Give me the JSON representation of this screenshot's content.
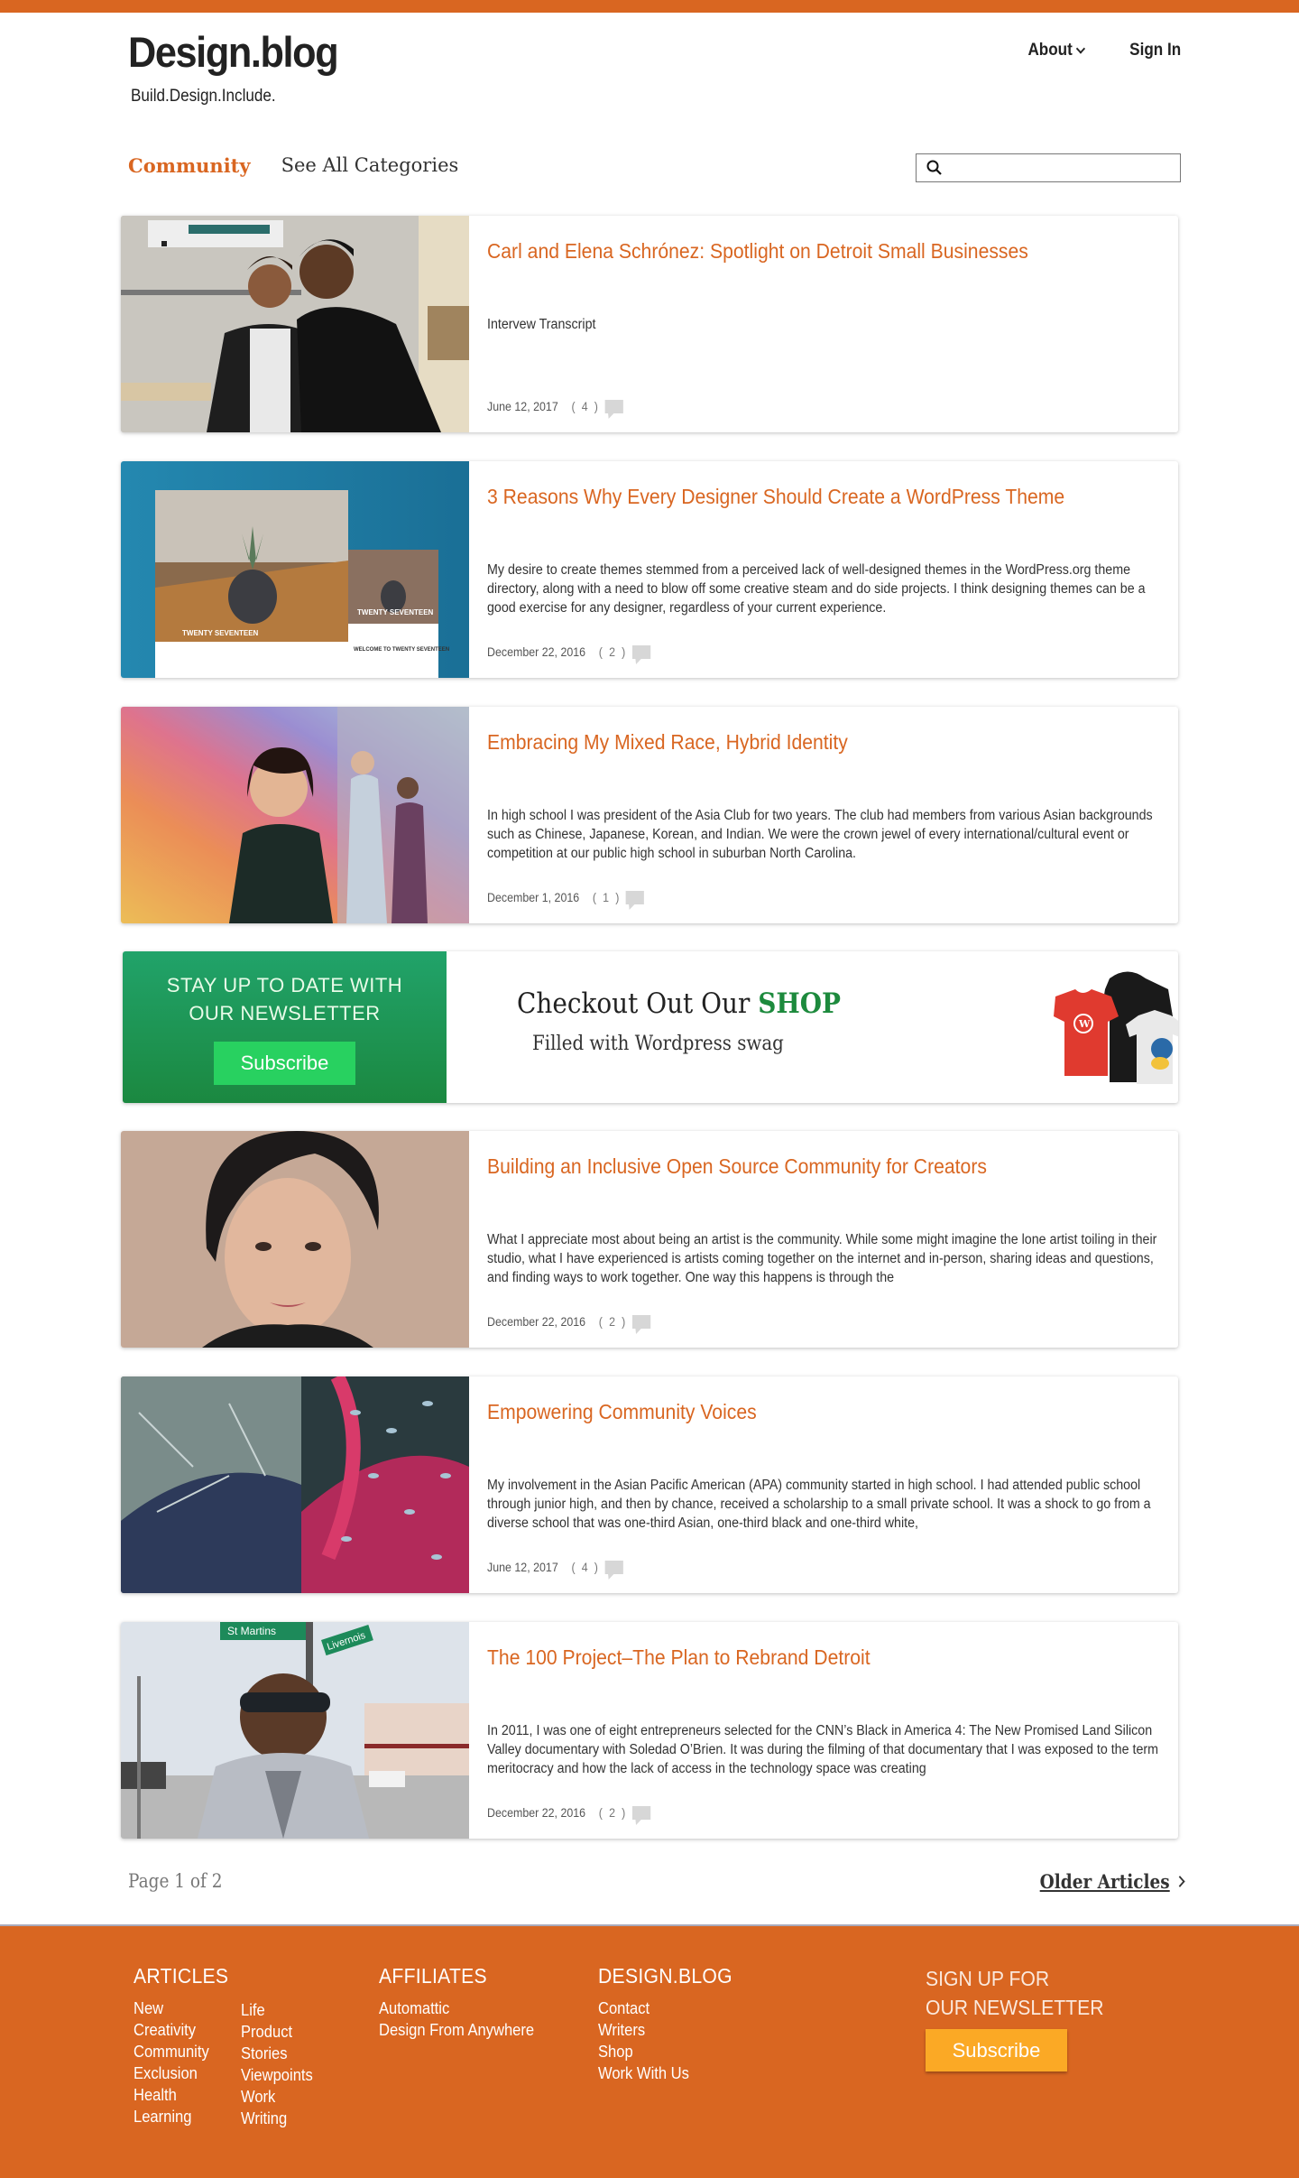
{
  "header": {
    "brand": "Design.blog",
    "tagline": "Build.Design.Include.",
    "nav": [
      {
        "label": "About",
        "icon": "chevron-down-icon"
      },
      {
        "label": "Sign In"
      }
    ]
  },
  "category_nav": {
    "active": "Community",
    "other": "See All Categories"
  },
  "search": {
    "icon": "search-icon",
    "value": "",
    "placeholder": ""
  },
  "articles": [
    {
      "title": "Carl and Elena Schrónez: Spotlight on Detroit Small Businesses",
      "excerpt": "Intervew Transcript",
      "date": "June 12, 2017",
      "comments": "( 4 )",
      "image": "couple-portrait"
    },
    {
      "title": "3 Reasons Why Every Designer Should Create a WordPress Theme",
      "excerpt": "My desire to create themes stemmed from a perceived lack of well-designed themes in the WordPress.org theme directory, along with a need to blow off some creative steam and do side projects. I think designing themes can be a good exercise for any designer, regardless of your current experience.",
      "date": "December 22, 2016",
      "comments": "( 2 )",
      "image": "twenty-seventeen-theme"
    },
    {
      "title": "Embracing My Mixed Race, Hybrid Identity",
      "excerpt": "In high school I was president of the Asia Club for two years. The club had members from various Asian backgrounds such as Chinese, Japanese, Korean, and Indian. We were the crown jewel of every international/cultural event or competition at our public high school in suburban North Carolina.",
      "date": "December 1, 2016",
      "comments": "( 1 )",
      "image": "rainbow-portrait"
    },
    {
      "title": "Building an Inclusive Open Source Community for Creators",
      "excerpt": "What I appreciate most about being an artist is the community. While some might imagine the lone artist toiling in their studio, what I have experienced is artists coming together on the internet and in-person, sharing ideas and questions, and finding ways to work together. One way this happens is through the",
      "date": "December 22, 2016",
      "comments": "( 2 )",
      "image": "woman-portrait"
    },
    {
      "title": "Empowering Community Voices",
      "excerpt": "My involvement in the Asian Pacific American (APA) community started in high school. I had attended public school through junior high, and then by chance, received a scholarship to a small private school. It was a shock to go from a diverse school that was one-third Asian, one-third black and one-third white,",
      "date": "June 12, 2017",
      "comments": "( 4 )",
      "image": "abstract-painting"
    },
    {
      "title": "The 100 Project–The Plan to Rebrand Detroit",
      "excerpt": "In 2011, I was one of eight entrepreneurs selected for the CNN’s Black in America 4: The New Promised Land Silicon Valley documentary with Soledad O’Brien. It was during the filming of that documentary that I was exposed to the term meritocracy and how the lack of access in the technology space was creating",
      "date": "December 22, 2016",
      "comments": "( 2 )",
      "image": "street-portrait"
    }
  ],
  "promo": {
    "newsletter_line1": "STAY  UP TO DATE WITH",
    "newsletter_line2": "OUR NEWSLETTER",
    "subscribe": "Subscribe",
    "shop_prefix": "Checkout Out Our ",
    "shop_highlight": "SHOP",
    "shop_sub": "Filled with Wordpress swag",
    "colors": {
      "green": "#1f9a55",
      "button": "#28d160",
      "shop": "#1d8a3d"
    }
  },
  "pagination": {
    "status": "Page 1 of 2",
    "older": "Older Articles"
  },
  "footer": {
    "articles": {
      "heading": "ARTICLES",
      "col1": [
        "New",
        "Creativity",
        "Community",
        "Exclusion",
        "Health",
        "Learning"
      ],
      "col2": [
        "Life",
        "Product",
        "Stories",
        "Viewpoints",
        "Work",
        "Writing"
      ]
    },
    "affiliates": {
      "heading": "AFFILIATES",
      "items": [
        "Automattic",
        "Design From Anywhere"
      ]
    },
    "designblog": {
      "heading": "DESIGN.BLOG",
      "items": [
        "Contact",
        "Writers",
        "Shop",
        "Work With Us"
      ]
    },
    "signup": {
      "line1": "SIGN UP FOR",
      "line2": "OUR NEWSLETTER",
      "button": "Subscribe"
    }
  },
  "colors": {
    "accent": "#d96621",
    "footer_button": "#fba925"
  }
}
